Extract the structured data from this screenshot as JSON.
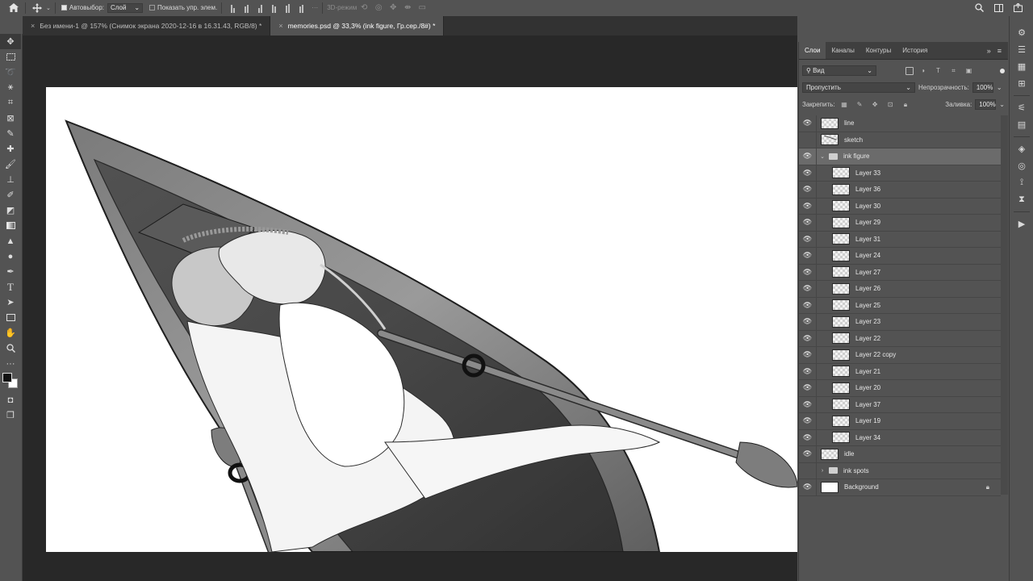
{
  "options_bar": {
    "home_icon": "home-icon",
    "move_tool_icon": "move-tool-icon",
    "autoselect_label": "Автовыбор:",
    "autoselect_checked": true,
    "autoselect_target": "Слой",
    "show_transform_label": "Показать упр. элем.",
    "show_transform_checked": false,
    "mode_3d_label": "3D-режим",
    "right_icons": [
      "search-icon",
      "workspace-icon",
      "share-icon"
    ]
  },
  "tabs": [
    {
      "label": "Без имени-1 @ 157% (Снимок экрана 2020-12-16 в 16.31.43, RGB/8) *",
      "active": false
    },
    {
      "label": "memories.psd @ 33,3% (ink figure, Гр.сер./8#) *",
      "active": true
    }
  ],
  "toolbar": {
    "tools": [
      "move-tool-icon",
      "marquee-tool-icon",
      "lasso-tool-icon",
      "magic-wand-icon",
      "crop-tool-icon",
      "frame-tool-icon",
      "eyedropper-icon",
      "healing-brush-icon",
      "brush-tool-icon",
      "clone-stamp-icon",
      "history-brush-icon",
      "eraser-icon",
      "gradient-tool-icon",
      "blur-tool-icon",
      "dodge-tool-icon",
      "pen-tool-icon",
      "type-tool-icon",
      "path-select-icon",
      "rectangle-tool-icon",
      "hand-tool-icon",
      "zoom-tool-icon",
      "more-tools-icon"
    ]
  },
  "panel": {
    "tabs": [
      "Слои",
      "Каналы",
      "Контуры",
      "История"
    ],
    "active_tab": "Слои",
    "filter_label": "Вид",
    "blend_mode": "Пропустить",
    "opacity_label": "Непрозрачность:",
    "opacity_value": "100%",
    "lock_label": "Закрепить:",
    "fill_label": "Заливка:",
    "fill_value": "100%"
  },
  "layers": [
    {
      "name": "line",
      "visible": true,
      "type": "layer",
      "indent": 0,
      "thumb": "checker"
    },
    {
      "name": "sketch",
      "visible": false,
      "type": "layer",
      "indent": 0,
      "thumb": "sketch"
    },
    {
      "name": "ink figure",
      "visible": true,
      "type": "group",
      "expanded": true,
      "indent": 0,
      "selected": true
    },
    {
      "name": "Layer 33",
      "visible": true,
      "type": "layer",
      "indent": 1,
      "thumb": "checker"
    },
    {
      "name": "Layer 36",
      "visible": true,
      "type": "layer",
      "indent": 1,
      "thumb": "checker"
    },
    {
      "name": "Layer 30",
      "visible": true,
      "type": "layer",
      "indent": 1,
      "thumb": "checker"
    },
    {
      "name": "Layer 29",
      "visible": true,
      "type": "layer",
      "indent": 1,
      "thumb": "checker"
    },
    {
      "name": "Layer 31",
      "visible": true,
      "type": "layer",
      "indent": 1,
      "thumb": "checker"
    },
    {
      "name": "Layer 24",
      "visible": true,
      "type": "layer",
      "indent": 1,
      "thumb": "checker"
    },
    {
      "name": "Layer 27",
      "visible": true,
      "type": "layer",
      "indent": 1,
      "thumb": "checker"
    },
    {
      "name": "Layer 26",
      "visible": true,
      "type": "layer",
      "indent": 1,
      "thumb": "checker"
    },
    {
      "name": "Layer 25",
      "visible": true,
      "type": "layer",
      "indent": 1,
      "thumb": "checker"
    },
    {
      "name": "Layer 23",
      "visible": true,
      "type": "layer",
      "indent": 1,
      "thumb": "checker"
    },
    {
      "name": "Layer 22",
      "visible": true,
      "type": "layer",
      "indent": 1,
      "thumb": "checker"
    },
    {
      "name": "Layer 22 copy",
      "visible": true,
      "type": "layer",
      "indent": 1,
      "thumb": "checker"
    },
    {
      "name": "Layer 21",
      "visible": true,
      "type": "layer",
      "indent": 1,
      "thumb": "checker"
    },
    {
      "name": "Layer 20",
      "visible": true,
      "type": "layer",
      "indent": 1,
      "thumb": "checker"
    },
    {
      "name": "Layer 37",
      "visible": true,
      "type": "layer",
      "indent": 1,
      "thumb": "checker"
    },
    {
      "name": "Layer 19",
      "visible": true,
      "type": "layer",
      "indent": 1,
      "thumb": "checker"
    },
    {
      "name": "Layer 34",
      "visible": true,
      "type": "layer",
      "indent": 1,
      "thumb": "checker"
    },
    {
      "name": "idle",
      "visible": true,
      "type": "layer",
      "indent": 0,
      "thumb": "checker"
    },
    {
      "name": "ink spots",
      "visible": false,
      "type": "group",
      "expanded": false,
      "indent": 0
    },
    {
      "name": "Background",
      "visible": true,
      "type": "layer",
      "indent": 0,
      "thumb": "white",
      "locked": true
    }
  ],
  "dock": {
    "icons": [
      "libraries-icon",
      "adjust-icon",
      "swatches-icon",
      "grid-icon",
      "properties-icon",
      "layers-icon",
      "channels-icon",
      "paths-icon",
      "history-icon",
      "play-icon"
    ]
  },
  "colors": {
    "ui_bg": "#535353",
    "canvas_bg": "#282828",
    "tab_bg": "#323232",
    "selection": "#6b6b6b"
  }
}
